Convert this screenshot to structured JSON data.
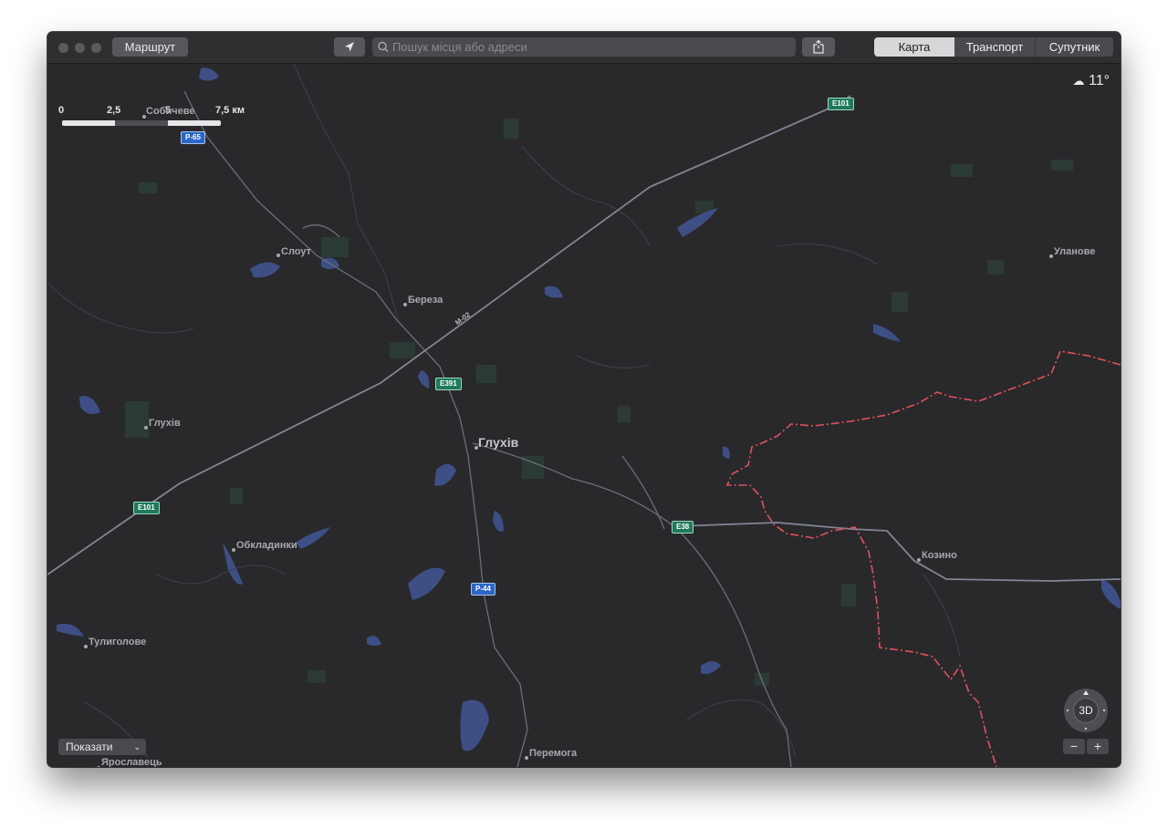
{
  "toolbar": {
    "route_label": "Маршрут",
    "search_placeholder": "Пошук місця або адреси",
    "view_modes": [
      "Карта",
      "Транспорт",
      "Супутник"
    ]
  },
  "map": {
    "scale": {
      "ticks": [
        "0",
        "2,5",
        "5",
        "7,5 км"
      ]
    },
    "weather": {
      "icon": "cloud-icon",
      "temperature": "11°"
    },
    "show_label": "Показати",
    "compass_label": "3D",
    "zoom_out": "−",
    "zoom_in": "+",
    "places": {
      "hlukhiv_main": "Глухів",
      "hlukhiv_small": "Глухів",
      "slout": "Слоут",
      "bereza": "Береза",
      "sobycheve": "Собичеве",
      "ulanove": "Уланове",
      "kozyno": "Козино",
      "obkladynky": "Обкладинки",
      "tulyholove": "Тулиголове",
      "yaroslavets": "Ярославець",
      "peremoha": "Перемога"
    },
    "roads": {
      "p65": "P-65",
      "p44": "P-44",
      "e101_top": "E101",
      "e101_left": "E101",
      "e391": "E391",
      "e38": "E38",
      "m02": "M-02"
    },
    "colors": {
      "background": "#29292c",
      "water": "#3e4f86",
      "border": "#e0515a",
      "road": "#7f8694"
    }
  }
}
